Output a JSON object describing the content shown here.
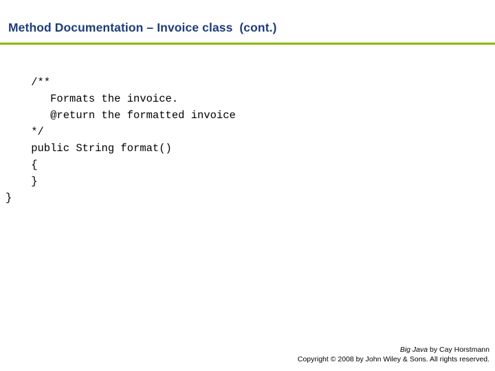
{
  "slide": {
    "title": "Method Documentation – Invoice class  (cont.)",
    "accent_color": "#8CB800",
    "title_color": "#1F3D7A",
    "code": "    /**\n       Formats the invoice.\n       @return the formatted invoice\n    */\n    public String format()\n    {\n    }\n}",
    "footer": {
      "book": "Big Java",
      "byline": " by Cay Horstmann",
      "copyright": "Copyright © 2008 by John Wiley & Sons.  All rights reserved."
    }
  }
}
